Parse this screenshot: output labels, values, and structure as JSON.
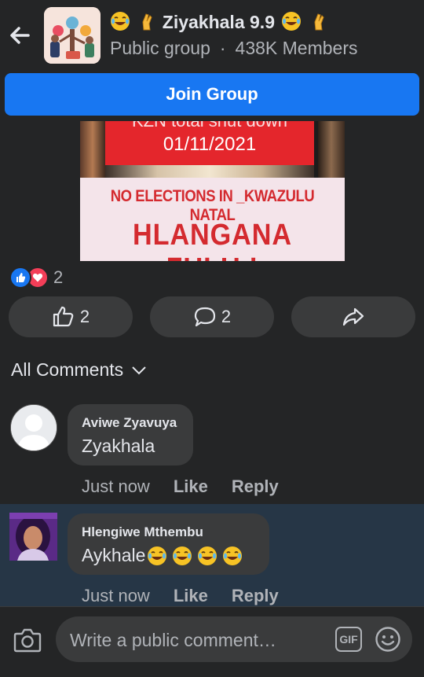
{
  "header": {
    "group_name": "Ziyakhala 9.9",
    "privacy": "Public group",
    "separator": "·",
    "members": "438K Members",
    "back_icon": "arrow-left-icon",
    "name_emojis": [
      "laughing-tears-emoji",
      "crossed-fingers-emoji"
    ]
  },
  "join_button": {
    "label": "Join Group"
  },
  "poster": {
    "top_partial": "KZN total shut down",
    "date": "01/11/2021",
    "line1": "NO ELECTIONS IN _KWAZULU NATAL",
    "line2": "HLANGANA ZULU",
    "exclaim": "!"
  },
  "reactions": {
    "count": "2",
    "icons": [
      "like-reaction-icon",
      "love-reaction-icon"
    ]
  },
  "actions": {
    "like_count": "2",
    "comment_count": "2"
  },
  "comments_filter": {
    "label": "All Comments"
  },
  "comments": [
    {
      "author": "Aviwe Zyavuya",
      "text": "Zyakhala",
      "time": "Just now",
      "like": "Like",
      "reply": "Reply"
    },
    {
      "author": "Hlengiwe Mthembu",
      "text": "Aykhale",
      "time": "Just now",
      "like": "Like",
      "reply": "Reply",
      "emoji_count": 4
    }
  ],
  "composer": {
    "placeholder": "Write a public comment…",
    "gif": "GIF"
  },
  "colors": {
    "background": "#242526",
    "accent": "#1877f2",
    "bubble": "#3a3b3c",
    "highlight_row": "#263646",
    "poster_red": "#e4262c"
  }
}
